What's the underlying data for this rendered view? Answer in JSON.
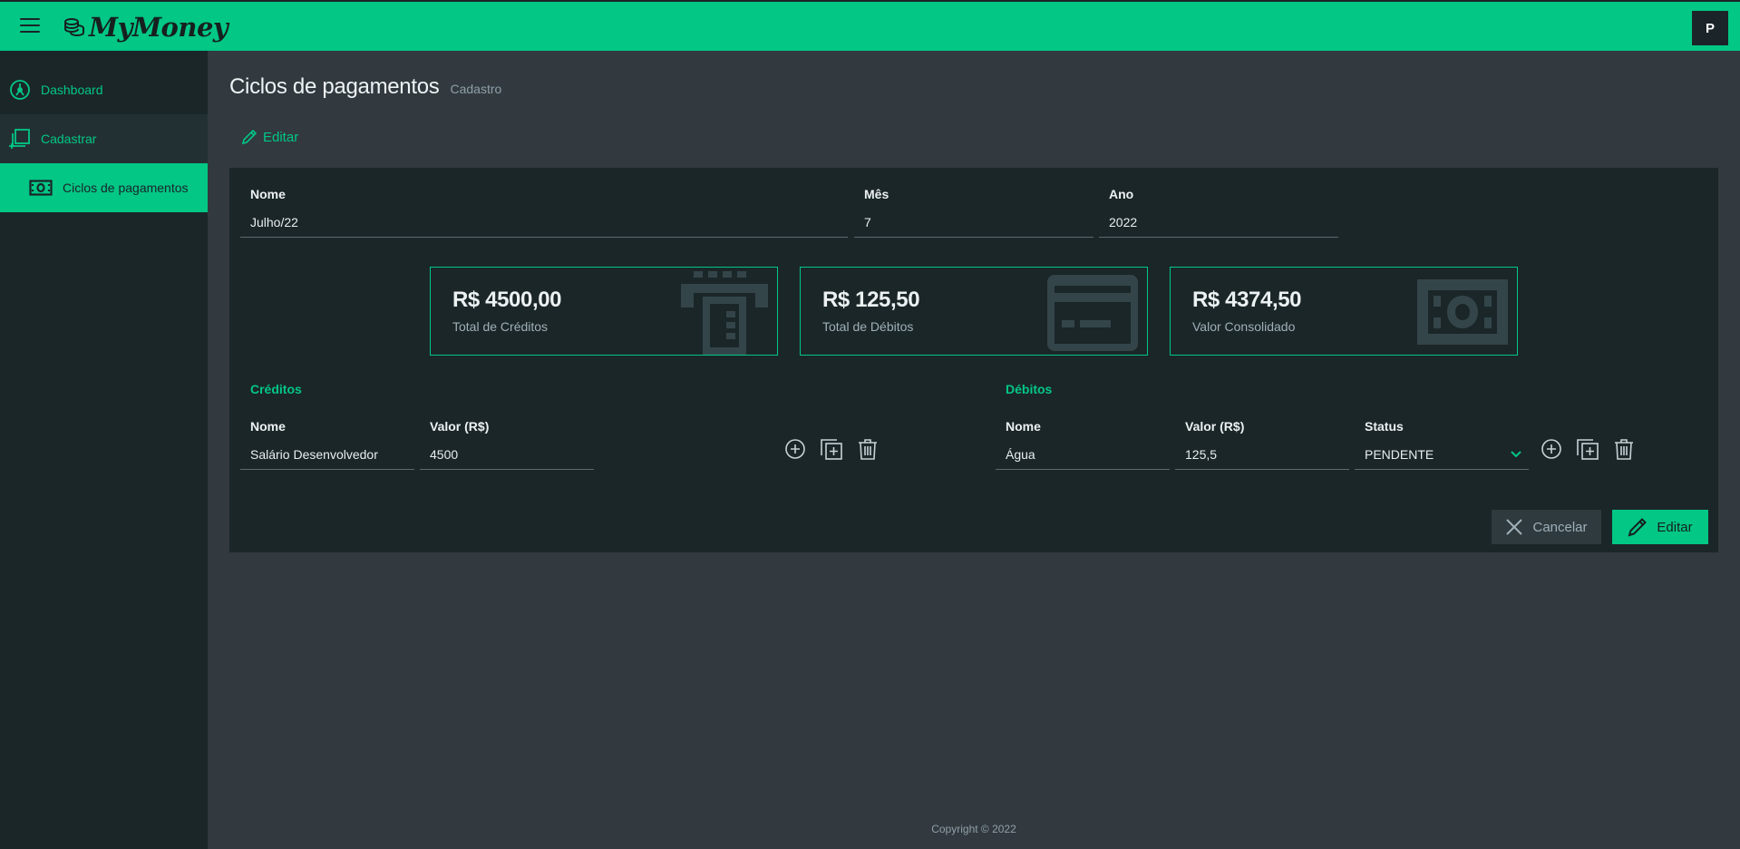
{
  "app": {
    "logo_text": "MyMoney",
    "user_initial": "P",
    "brand_color": "#02c785"
  },
  "sidebar": {
    "items": [
      {
        "label": "Dashboard",
        "icon": "dashboard-icon"
      },
      {
        "label": "Cadastrar",
        "icon": "add-copy-icon"
      }
    ],
    "sub_items": [
      {
        "label": "Ciclos de pagamentos",
        "icon": "money-icon"
      }
    ]
  },
  "page": {
    "title": "Ciclos de pagamentos",
    "subtitle": "Cadastro",
    "tab_label": "Editar"
  },
  "form": {
    "name_label": "Nome",
    "name_value": "Julho/22",
    "month_label": "Mês",
    "month_value": "7",
    "year_label": "Ano",
    "year_value": "2022"
  },
  "summary": [
    {
      "value": "R$ 4500,00",
      "label": "Total de Créditos",
      "icon": "atm-icon"
    },
    {
      "value": "R$ 125,50",
      "label": "Total de Débitos",
      "icon": "credit-card-icon"
    },
    {
      "value": "R$ 4374,50",
      "label": "Valor Consolidado",
      "icon": "money-icon"
    }
  ],
  "credits": {
    "title": "Créditos",
    "name_label": "Nome",
    "value_label": "Valor (R$)",
    "rows": [
      {
        "name": "Salário Desenvolvedor",
        "value": "4500"
      }
    ]
  },
  "debts": {
    "title": "Débitos",
    "name_label": "Nome",
    "value_label": "Valor (R$)",
    "status_label": "Status",
    "rows": [
      {
        "name": "Água",
        "value": "125,5",
        "status": "PENDENTE"
      }
    ]
  },
  "buttons": {
    "cancel": "Cancelar",
    "save": "Editar"
  },
  "footer": "Copyright © 2022"
}
